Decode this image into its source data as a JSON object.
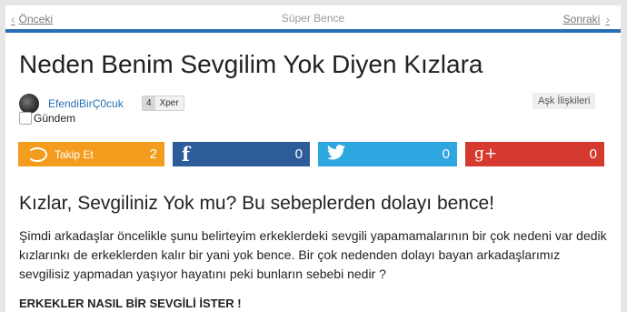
{
  "nav": {
    "prev_label": "Önceki",
    "next_label": "Sonraki",
    "section_title": "Süper Bence"
  },
  "article": {
    "title": "Neden Benim Sevgilim Yok Diyen Kızlara",
    "author": "EfendiBirÇ0cuk",
    "xp_level": "4",
    "xp_label": "Xper",
    "category": "Aşk İlişkileri",
    "tag": "Gündem",
    "heading": "Kızlar, Sevgiliniz Yok mu? Bu sebeplerden dolayı bence!",
    "paragraph": "Şimdi arkadaşlar öncelikle şunu belirteyim erkeklerdeki sevgili yapamamalarının bir çok nedeni var dedik kızlarınkı de erkeklerden kalır bir yani yok bence. Bir çok nedenden dolayı bayan arkadaşlarımız sevgilisiz yapmadan yaşıyor hayatını peki bunların sebebi nedir ?",
    "subheading": "ERKEKLER NASIL BİR SEVGİLİ İSTER !"
  },
  "social": {
    "follow_label": "Takip Et",
    "follow_count": "2",
    "facebook_count": "0",
    "twitter_count": "0",
    "googleplus_count": "0",
    "googleplus_glyph": "g+",
    "facebook_glyph": "f"
  },
  "colors": {
    "accent": "#2a6fb5",
    "follow": "#f39c1e",
    "facebook": "#2d5c9a",
    "twitter": "#2ea7e0",
    "googleplus": "#d63a2f"
  },
  "icons": [
    "chevron-left-icon",
    "chevron-right-icon",
    "follow-icon",
    "facebook-icon",
    "twitter-icon",
    "googleplus-icon"
  ]
}
